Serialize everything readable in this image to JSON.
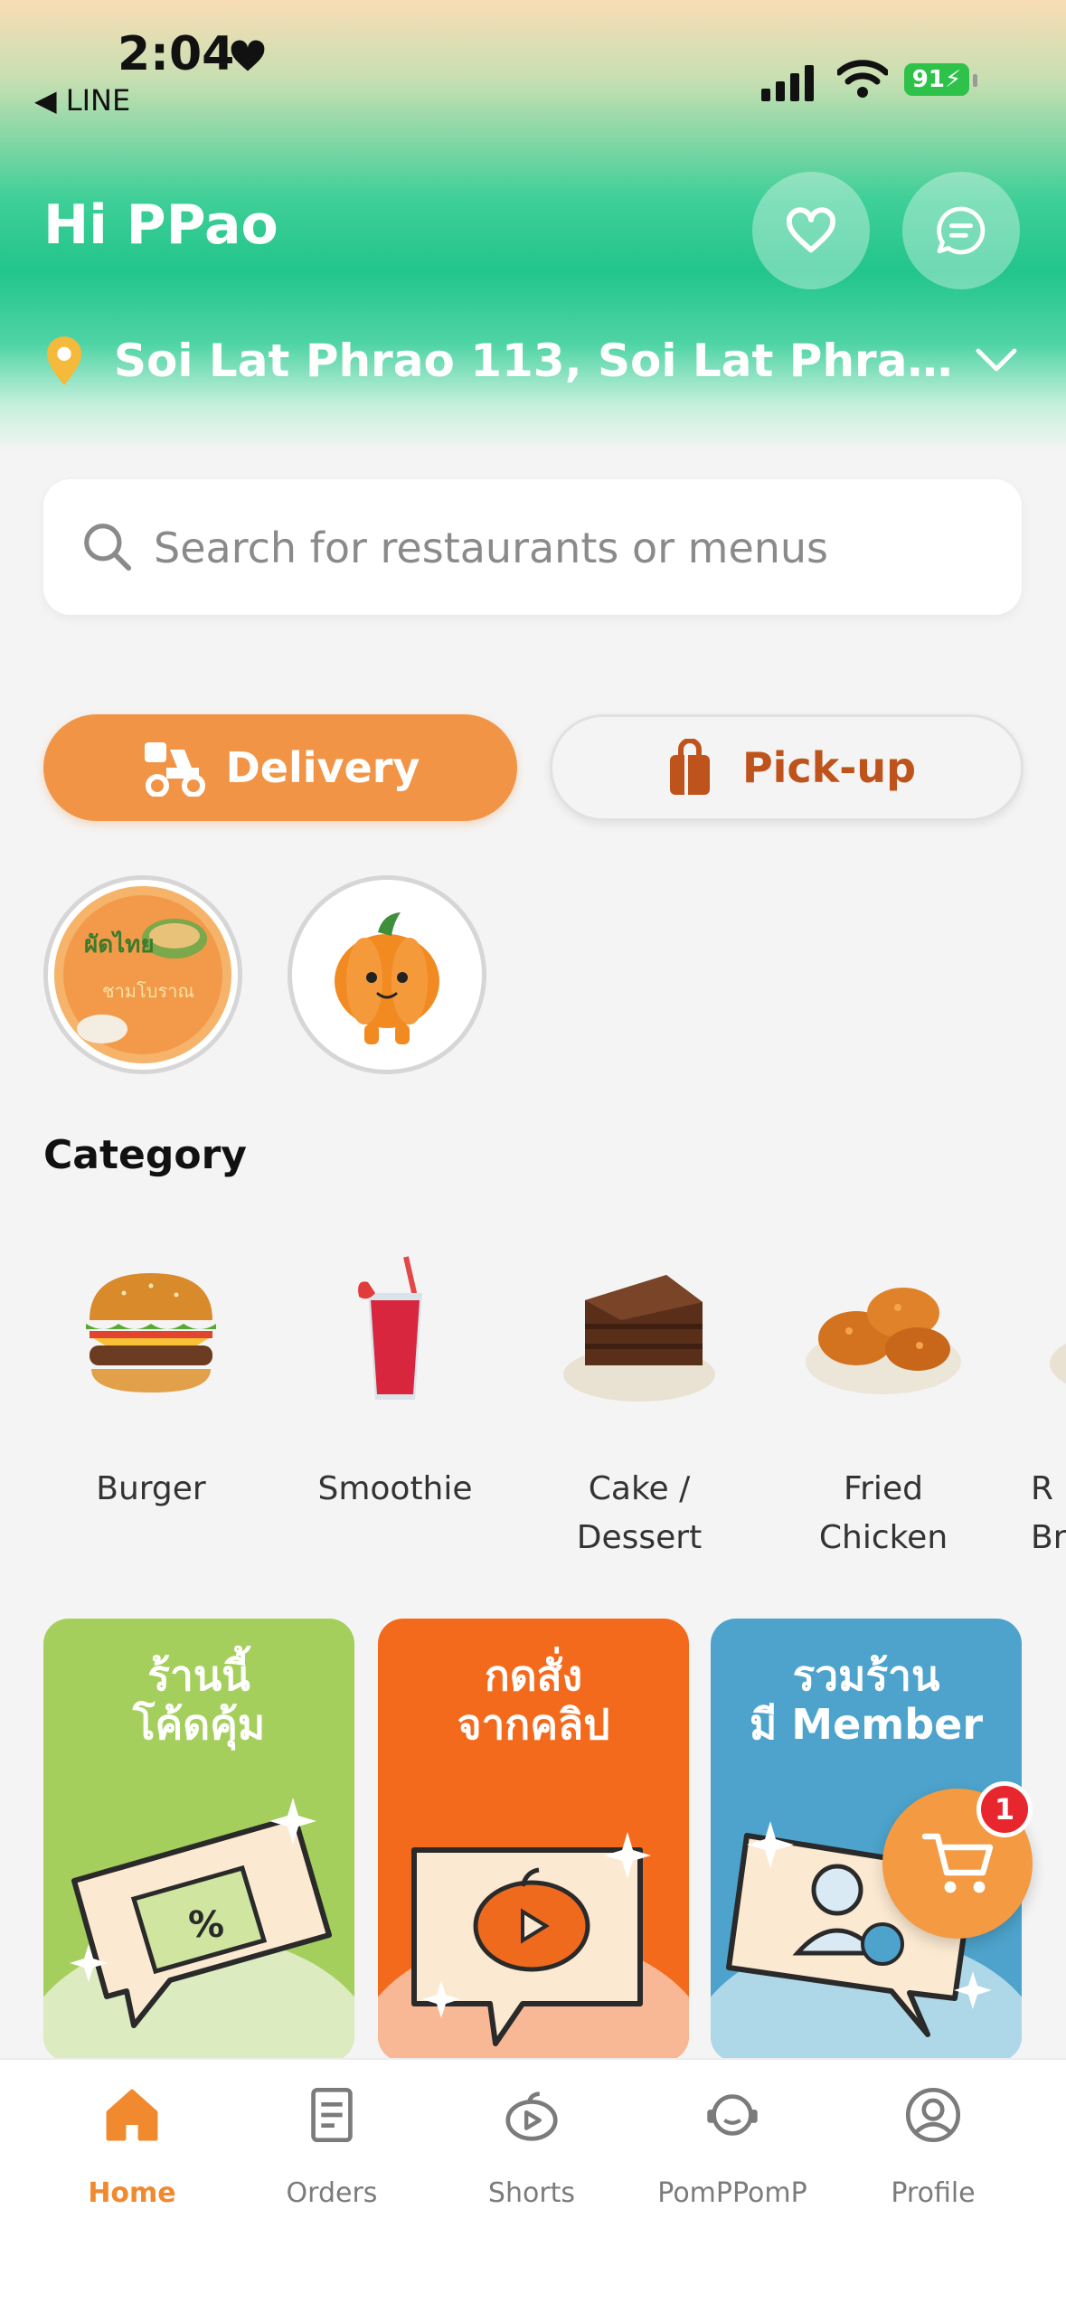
{
  "status_bar": {
    "time": "2:04",
    "back_label": "◀ LINE",
    "battery": "91"
  },
  "header": {
    "greeting": "Hi PPao",
    "address": "Soi Lat Phrao 113, Soi Lat Phrao 113,...",
    "favorites_icon": "heart-icon",
    "messages_icon": "chat-icon"
  },
  "search": {
    "placeholder": "Search for restaurants or menus"
  },
  "modes": [
    {
      "label": "Delivery",
      "selected": true
    },
    {
      "label": "Pick-up",
      "selected": false
    }
  ],
  "stories": [
    "pad-thai-restaurant-logo",
    "pumpkin-mascot"
  ],
  "category": {
    "title": "Category",
    "items": [
      {
        "label_line1": "Burger",
        "label_line2": ""
      },
      {
        "label_line1": "Smoothie",
        "label_line2": ""
      },
      {
        "label_line1": "Cake /",
        "label_line2": "Dessert"
      },
      {
        "label_line1": "Fried",
        "label_line2": "Chicken"
      },
      {
        "label_line1": "R",
        "label_line2": "Bra"
      }
    ]
  },
  "promos": [
    {
      "line1": "ร้านนี้",
      "line2": "โค้ดคุ้ม",
      "color": "#a5cf5d"
    },
    {
      "line1": "กดสั่ง",
      "line2": "จากคลิป",
      "color": "#f46a1c"
    },
    {
      "line1": "รวมร้าน",
      "line2": "มี Member",
      "color": "#4da3cc"
    }
  ],
  "cart": {
    "badge": "1",
    "color": "#f39a43"
  },
  "tabbar": {
    "items": [
      {
        "label": "Home",
        "active": true
      },
      {
        "label": "Orders",
        "active": false
      },
      {
        "label": "Shorts",
        "active": false
      },
      {
        "label": "PomPPomP",
        "active": false
      },
      {
        "label": "Profile",
        "active": false
      }
    ]
  },
  "colors": {
    "accent": "#f19446",
    "header_green": "#22c58c",
    "pickup_text": "#bf531c"
  }
}
